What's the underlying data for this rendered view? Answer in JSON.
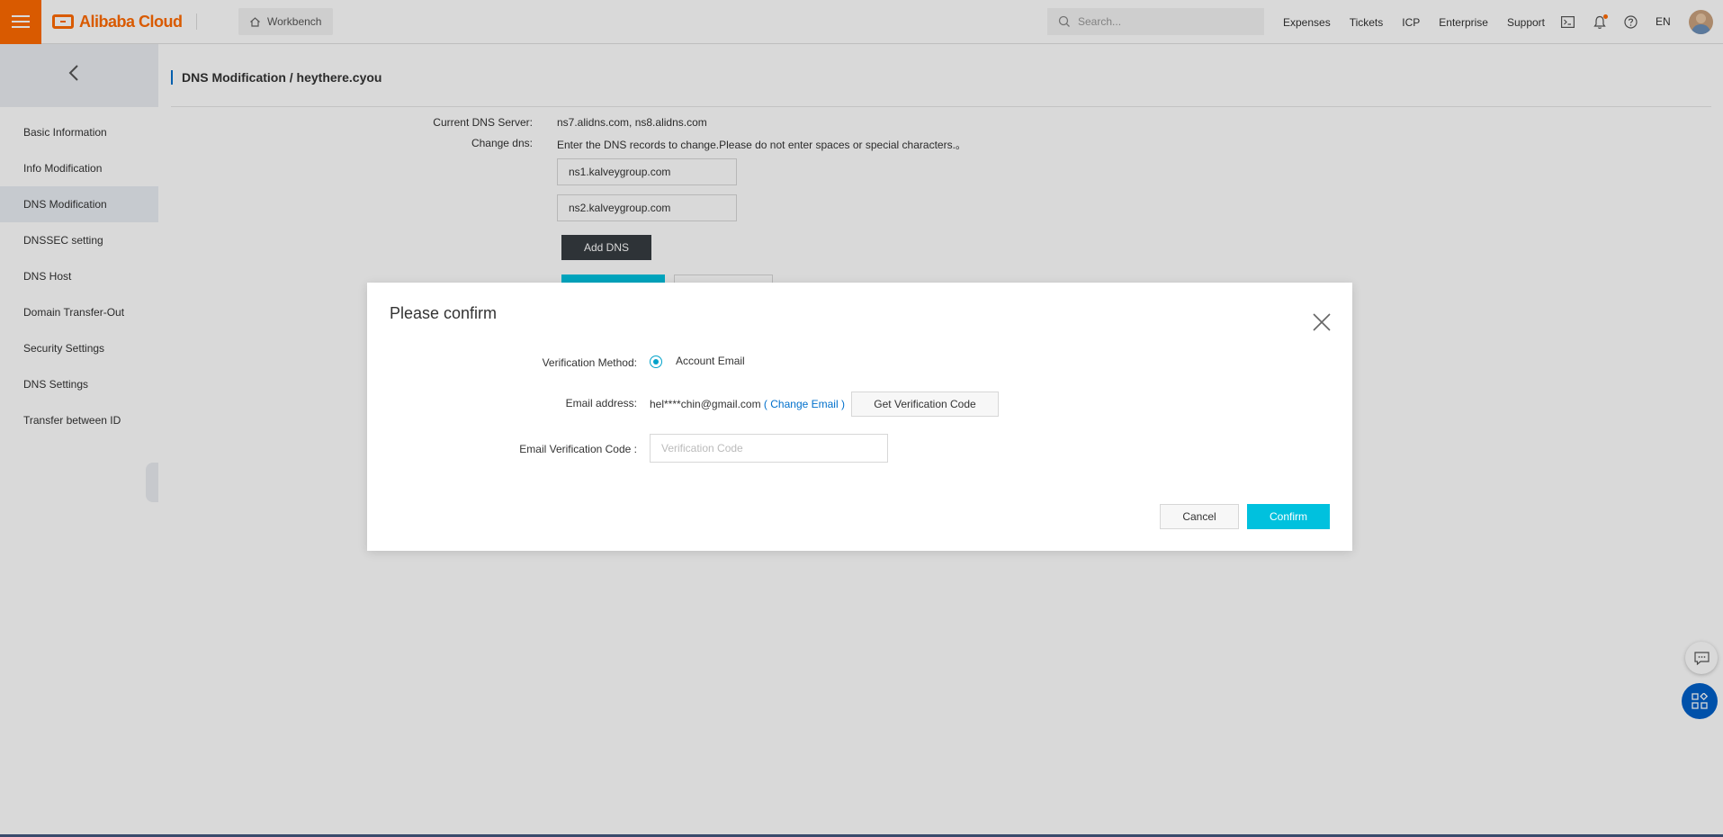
{
  "header": {
    "brand": "Alibaba Cloud",
    "workbench_label": "Workbench",
    "search_placeholder": "Search...",
    "links": [
      "Expenses",
      "Tickets",
      "ICP",
      "Enterprise",
      "Support"
    ],
    "language": "EN",
    "accent_color": "#ff6a00"
  },
  "sidebar": {
    "items": [
      {
        "label": "Basic Information"
      },
      {
        "label": "Info Modification"
      },
      {
        "label": "DNS Modification"
      },
      {
        "label": "DNSSEC setting"
      },
      {
        "label": "DNS Host"
      },
      {
        "label": "Domain Transfer-Out"
      },
      {
        "label": "Security Settings"
      },
      {
        "label": "DNS Settings"
      },
      {
        "label": "Transfer between ID"
      }
    ],
    "active": "DNS Modification"
  },
  "main": {
    "title": "DNS Modification / heythere.cyou",
    "current_dns_label": "Current DNS Server:",
    "current_dns_value": "ns7.alidns.com, ns8.alidns.com",
    "change_dns_label": "Change dns:",
    "change_dns_hint": "Enter the DNS records to change.Please do not enter spaces or special characters.。",
    "dns_records": [
      "ns1.kalveygroup.com",
      "ns2.kalveygroup.com"
    ],
    "add_dns_label": "Add DNS"
  },
  "dialog": {
    "title": "Please confirm",
    "verification_method_label": "Verification Method:",
    "verification_method_option": "Account Email",
    "email_label": "Email address:",
    "email_value": "hel****chin@gmail.com",
    "change_email_label": "( Change Email )",
    "get_code_label": "Get Verification Code",
    "code_label": "Email Verification Code :",
    "code_placeholder": "Verification Code",
    "cancel_label": "Cancel",
    "confirm_label": "Confirm",
    "confirm_color": "#00c1de",
    "link_color": "#0070cc"
  }
}
